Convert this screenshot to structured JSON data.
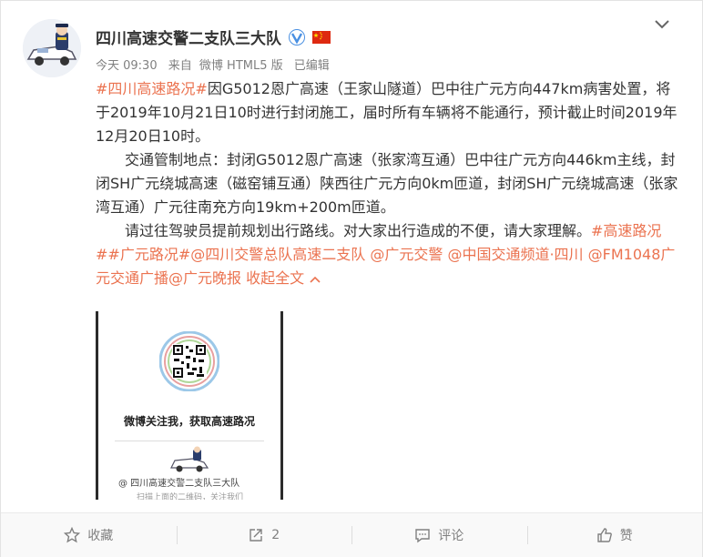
{
  "post": {
    "author": "四川高速交警二支队三大队",
    "meta": {
      "time": "今天 09:30",
      "source_prefix": "来自",
      "source": "微博 HTML5 版",
      "edited": "已编辑"
    },
    "para1": {
      "hashtag": "#四川高速路况#",
      "text": "因G5012恩广高速（王家山隧道）巴中往广元方向447km病害处置，将于2019年10月21日10时进行封闭施工，届时所有车辆将不能通行，预计截止时间2019年12月20日10时。"
    },
    "para2": "交通管制地点：封闭G5012恩广高速（张家湾互通）巴中往广元方向446km主线，封闭SH广元绕城高速（磁窑铺互通）陕西往广元方向0km匝道，封闭SH广元绕城高速（张家湾互通）广元往南充方向19km+200m匝道。",
    "para3": {
      "text": "请过往驾驶员提前规划出行路线。对大家出行造成的不便，请大家理解。",
      "tags": [
        "#高速路况#",
        "#广元路况#",
        "@四川交警总队高速二支队",
        "@广元交警",
        "@中国交通频道·四川",
        "@FM1048广元交通广播",
        "@广元晚报"
      ],
      "collapse": "收起全文"
    },
    "image": {
      "caption": "微博关注我，获取高速路况",
      "account": "@  四川高速交警二支队三大队",
      "sub": "扫描上面的二维码，关注我们"
    }
  },
  "footer": {
    "favorite": "收藏",
    "repost_count": "2",
    "comment": "评论",
    "like": "赞"
  },
  "icons": {
    "verified": "verified-badge-icon",
    "flag": "china-flag-icon",
    "menu": "chevron-down-icon",
    "favorite": "star-icon",
    "repost": "repost-icon",
    "comment": "comment-icon",
    "like": "thumbs-up-icon"
  },
  "colors": {
    "link": "#eb7350",
    "verified": "#4a90e2",
    "text": "#333333",
    "meta": "#808080"
  }
}
